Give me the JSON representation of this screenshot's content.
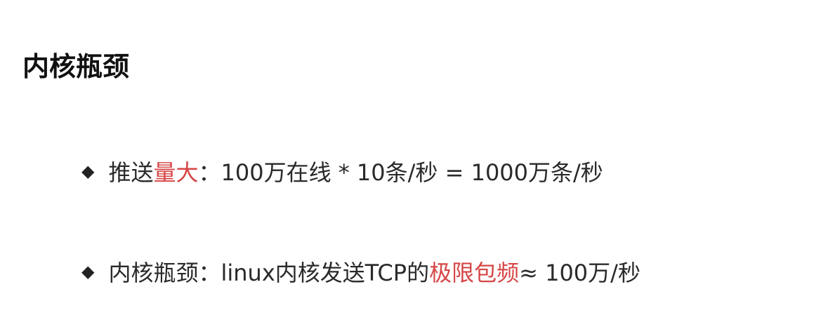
{
  "colors": {
    "accent_red": "#d64545",
    "text": "#222222",
    "background": "#ffffff"
  },
  "heading": "内核瓶颈",
  "bullets": [
    {
      "icon": "diamond-bullet-icon",
      "prefix": "推送",
      "highlight": "量大",
      "suffix": "：100万在线 * 10条/秒 = 1000万条/秒"
    },
    {
      "icon": "diamond-bullet-icon",
      "prefix": "内核瓶颈：linux内核发送TCP的",
      "highlight": "极限包频",
      "suffix": " ≈ 100万/秒"
    }
  ]
}
